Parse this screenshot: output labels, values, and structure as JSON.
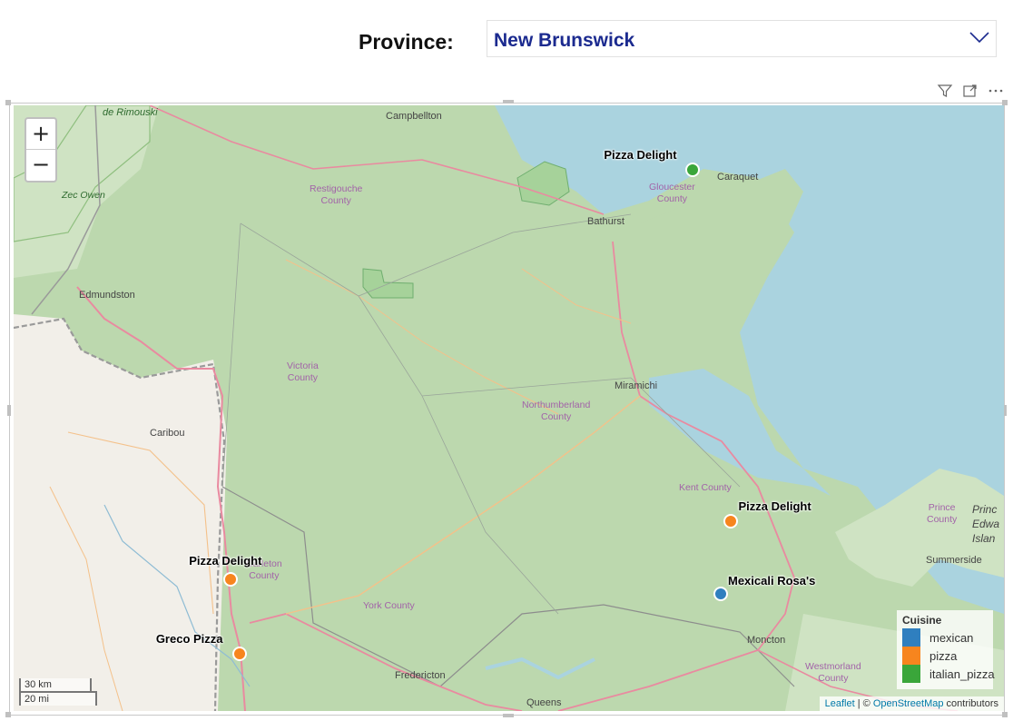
{
  "slicer": {
    "label": "Province:",
    "value": "New Brunswick"
  },
  "header_icons": [
    "filter-icon",
    "focus-mode-icon",
    "more-options-icon"
  ],
  "map": {
    "zoom": {
      "in_label": "+",
      "out_label": "−"
    },
    "scale": {
      "km": "30 km",
      "mi": "20 mi"
    },
    "attribution": {
      "leaflet": "Leaflet",
      "separator": " | © ",
      "osm": "OpenStreetMap",
      "suffix": " contributors"
    },
    "places": {
      "campbellton": "Campbellton",
      "rimouski": "de Rimouski",
      "bathurst": "Bathurst",
      "edmundston": "Edmundston",
      "miramichi": "Miramichi",
      "caribou": "Caribou",
      "fredericton": "Fredericton",
      "queens": "Queens",
      "summerside": "Summerside",
      "moncton": "Moncton",
      "caraquet": "Caraquet",
      "pei": "Princ\nEdwa\nIslan"
    },
    "counties": {
      "restigouche": "Restigouche\nCounty",
      "gloucester": "Gloucester\nCounty",
      "victoria": "Victoria\nCounty",
      "northumberland": "Northumberland\nCounty",
      "kent": "Kent County",
      "carleton": "Carleton\nCounty",
      "york": "York County",
      "westmorland": "Westmorland\nCounty",
      "prince": "Prince\nCounty"
    },
    "parks": {
      "zec_owen": "Zec Owen"
    },
    "markers": [
      {
        "label": "Pizza Delight",
        "cuisine": "italian_pizza",
        "lat": 47.79,
        "lon": -64.94
      },
      {
        "label": "Pizza Delight",
        "cuisine": "pizza",
        "lat": 46.38,
        "lon": -64.72
      },
      {
        "label": "Pizza Delight",
        "cuisine": "pizza",
        "lat": 46.15,
        "lon": -67.6
      },
      {
        "label": "Greco Pizza",
        "cuisine": "pizza",
        "lat": 45.85,
        "lon": -67.55
      },
      {
        "label": "Mexicali Rosa's",
        "cuisine": "mexican",
        "lat": 46.09,
        "lon": -64.78
      }
    ]
  },
  "legend": {
    "title": "Cuisine",
    "items": [
      {
        "label": "mexican",
        "color": "#2f7fbf"
      },
      {
        "label": "pizza",
        "color": "#f7851e"
      },
      {
        "label": "italian_pizza",
        "color": "#3aa63a"
      }
    ]
  },
  "colors": {
    "mexican": "#2f7fbf",
    "pizza": "#f7851e",
    "italian_pizza": "#3aa63a",
    "water": "#aad3df",
    "land_nb": "#bcd8ae",
    "land_maine": "#f2efe9"
  }
}
